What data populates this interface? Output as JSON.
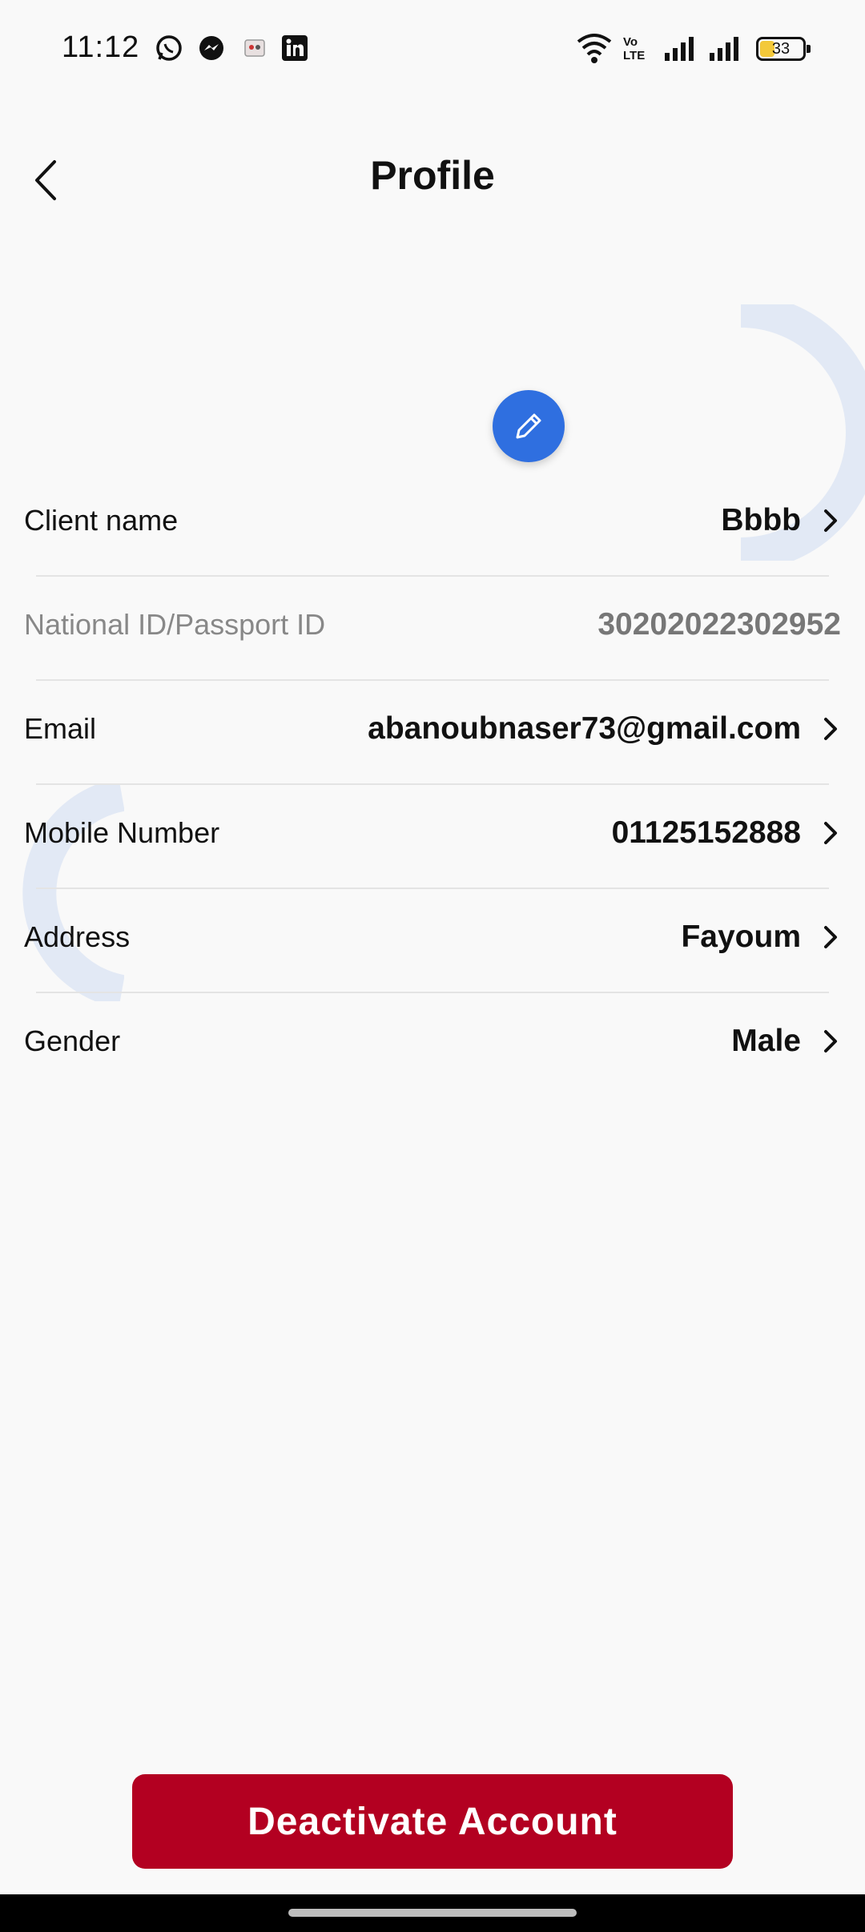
{
  "status_bar": {
    "time": "11:12",
    "battery": "33",
    "network_label": "Vo LTE"
  },
  "header": {
    "title": "Profile",
    "back_icon": "chevron-left-icon"
  },
  "avatar": {
    "edit_icon": "pencil-icon"
  },
  "rows": [
    {
      "label": "Client name",
      "value": "Bbbb"
    },
    {
      "label": "National ID/Passport ID",
      "value": "30202022302952"
    },
    {
      "label": "Email",
      "value": "abanoubnaser73@gmail.com"
    },
    {
      "label": "Mobile Number",
      "value": "01125152888"
    },
    {
      "label": "Address",
      "value": "Fayoum"
    },
    {
      "label": "Gender",
      "value": "Male"
    }
  ],
  "footer": {
    "deactivate_label": "Deactivate Account"
  },
  "colors": {
    "accent": "#2f6fe0",
    "danger": "#b30021",
    "background": "#f9f9f9"
  }
}
